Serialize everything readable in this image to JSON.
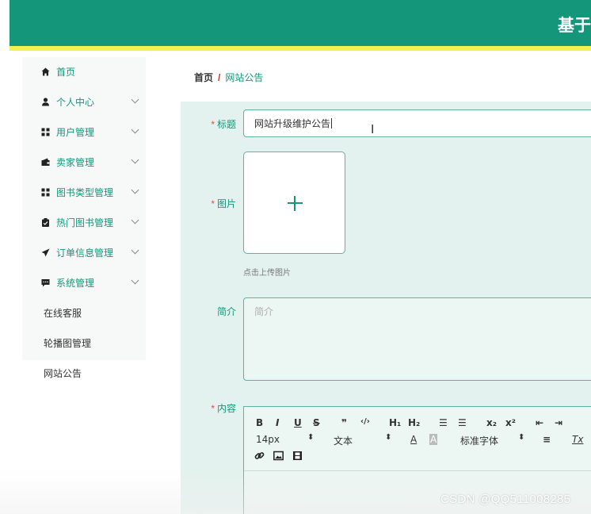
{
  "header": {
    "title": "基于v",
    "color": "#13967a",
    "accent_bar_color": "#f6f04e"
  },
  "sidebar": {
    "items": [
      {
        "label": "首页",
        "icon": "home-icon",
        "expandable": false
      },
      {
        "label": "个人中心",
        "icon": "user-icon",
        "expandable": true
      },
      {
        "label": "用户管理",
        "icon": "grid-icon",
        "expandable": true
      },
      {
        "label": "卖家管理",
        "icon": "wallet-icon",
        "expandable": true
      },
      {
        "label": "图书类型管理",
        "icon": "grid-icon",
        "expandable": true
      },
      {
        "label": "热门图书管理",
        "icon": "clipboard-icon",
        "expandable": true
      },
      {
        "label": "订单信息管理",
        "icon": "send-icon",
        "expandable": true
      },
      {
        "label": "系统管理",
        "icon": "chat-icon",
        "expandable": true
      }
    ],
    "sub_items": [
      {
        "label": "在线客服"
      },
      {
        "label": "轮播图管理"
      },
      {
        "label": "网站公告"
      }
    ]
  },
  "breadcrumb": {
    "home": "首页",
    "separator": "/",
    "current": "网站公告"
  },
  "form": {
    "title_label": "标题",
    "title_value": "网站升级维护公告",
    "image_label": "图片",
    "upload_tip": "点击上传图片",
    "intro_label": "简介",
    "intro_placeholder": "简介",
    "content_label": "内容",
    "required_mark": "*"
  },
  "editor_toolbar": {
    "bold": "B",
    "italic": "I",
    "underline": "U",
    "strike": "S",
    "quote": "❞",
    "code": "‹/›",
    "h1": "H₁",
    "h2": "H₂",
    "ordered_list": "☰",
    "bullet_list": "☰",
    "subscript": "x₂",
    "superscript": "x²",
    "outdent": "⇤",
    "indent": "⇥",
    "font_size": "14px",
    "text_type": "文本",
    "font_family": "标准字体",
    "color": "A",
    "background": "A",
    "align": "≡",
    "clear": "Tx"
  },
  "watermark": "CSDN @QQ511008285"
}
